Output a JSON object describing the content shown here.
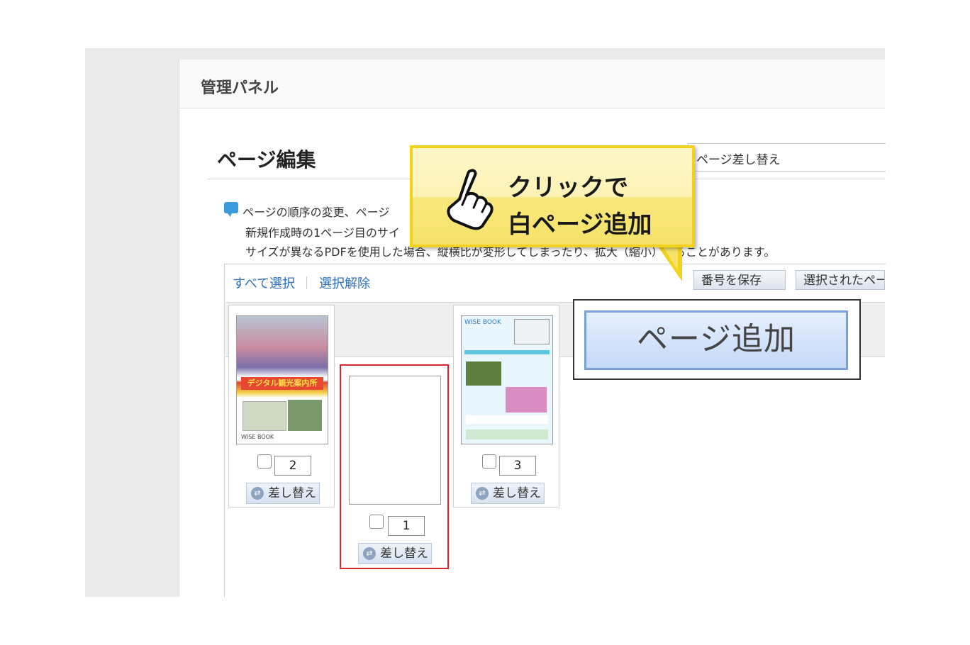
{
  "panel": {
    "title": "管理パネル"
  },
  "section": {
    "title": "ページ編集",
    "replace_label": "ページ差し替え"
  },
  "info": {
    "line1": "ページの順序の変更、ページ",
    "line2": "新規作成時の1ページ目のサイ",
    "line3": "サイズが異なるPDFを使用した場合、縦横比が変形してしまったり、拡大（縮小）することがあります。"
  },
  "toolbar": {
    "select_all": "すべて選択",
    "deselect": "選択解除",
    "save_numbers": "番号を保存",
    "selected_pages": "選択されたペー"
  },
  "callout": {
    "line1": "クリックで",
    "line2": "白ページ追加"
  },
  "zoom": {
    "add_page": "ページ追加"
  },
  "thumbnails": [
    {
      "number": "2",
      "replace": "差し替え",
      "title_text": "デジタル観光案内所",
      "footer": "WISE BOOK"
    },
    {
      "number": "1",
      "replace": "差し替え"
    },
    {
      "number": "3",
      "replace": "差し替え",
      "title_text": "WISE BOOK"
    }
  ],
  "colors": {
    "callout_border": "#f2d21a",
    "selected_border": "#d8262b",
    "link": "#2a6ebd",
    "info_icon": "#3a9bdc"
  }
}
